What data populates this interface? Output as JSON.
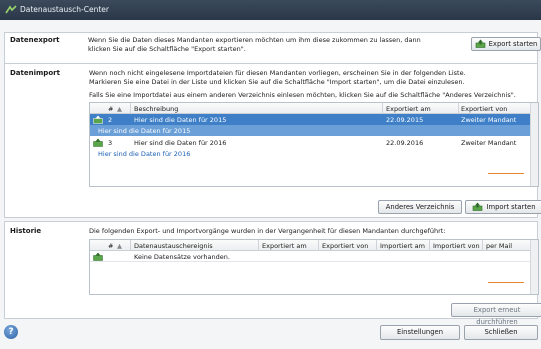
{
  "window": {
    "title": "Datenaustausch-Center"
  },
  "export": {
    "label": "Datenexport",
    "description_1": "Wenn Sie die Daten dieses Mandanten exportieren möchten um ihm diese zukommen zu lassen, dann",
    "description_2": "klicken Sie auf die Schaltfläche \"Export starten\".",
    "button": "Export starten"
  },
  "import": {
    "label": "Datenimport",
    "description_1": "Wenn noch nicht eingelesene Importdateien für diesen Mandanten vorliegen, erscheinen Sie in der folgenden Liste.",
    "description_2": "Markieren Sie eine Datei in der Liste und klicken Sie auf die Schaltfläche \"Import starten\", um die Datei einzulesen.",
    "description_3": "Falls Sie eine Importdatei aus einem anderen Verzeichnis einlesen möchten, klicken Sie auf die Schaltfläche \"Anderes Verzeichnis\".",
    "columns": {
      "num": "#",
      "desc": "Beschreibung",
      "exported_at": "Exportiert am",
      "exported_by": "Exportiert von"
    },
    "rows": [
      {
        "num": "2",
        "desc": "Hier sind die Daten für 2015",
        "exported_at": "22.09.2015",
        "exported_by": "Zweiter Mandant",
        "sub": "Hier sind die Daten für 2015"
      },
      {
        "num": "3",
        "desc": "Hier sind die Daten für 2016",
        "exported_at": "22.09.2016",
        "exported_by": "Zweiter Mandant",
        "sub": "Hier sind die Daten für 2016"
      }
    ],
    "btn_other_dir": "Anderes Verzeichnis",
    "btn_import": "Import starten"
  },
  "history": {
    "label": "Historie",
    "description": "Die folgenden Export- und Importvorgänge wurden in der Vergangenheit für diesen Mandanten durchgeführt:",
    "columns": {
      "num": "#",
      "event": "Datenaustauschereignis",
      "exported_at": "Exportiert am",
      "exported_by": "Exportiert von",
      "imported_at": "Importiert am",
      "imported_by": "Importiert von",
      "mail": "per Mail"
    },
    "empty_row": "Keine Datensätze vorhanden.",
    "btn_repeat_export": "Export erneut durchführen"
  },
  "footer": {
    "help": "?",
    "btn_settings": "Einstellungen",
    "btn_close": "Schließen"
  },
  "colors": {
    "selection": "#3e7fc7",
    "link": "#1a5fb4",
    "accent": "#e6892a"
  }
}
